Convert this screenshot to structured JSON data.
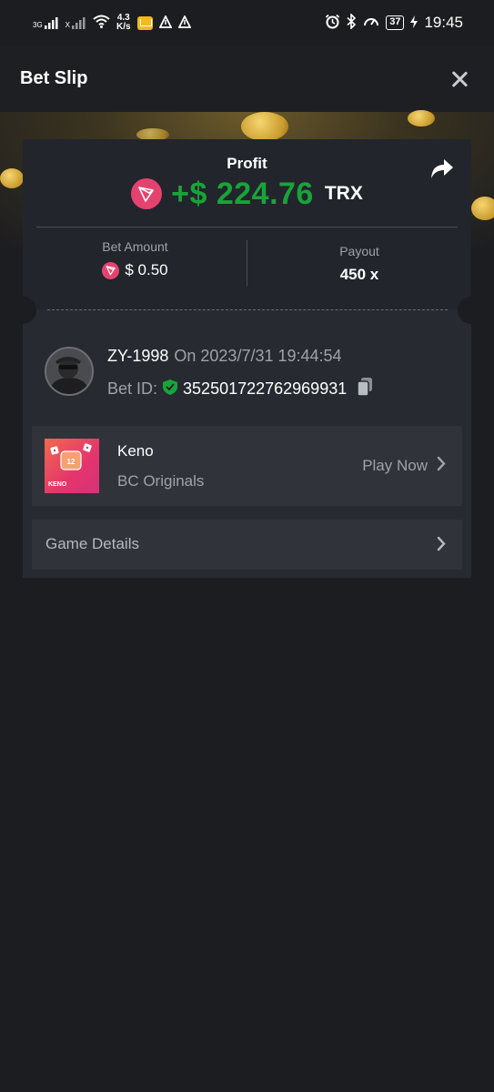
{
  "status_bar": {
    "network_1": "3G",
    "network_2": "X",
    "speed_value": "4.3",
    "speed_unit": "K/s",
    "battery": "37",
    "time": "19:45"
  },
  "header": {
    "title": "Bet Slip"
  },
  "profit": {
    "label": "Profit",
    "value": "+$ 224.76",
    "currency": "TRX"
  },
  "bet_amount": {
    "label": "Bet Amount",
    "value": "$ 0.50"
  },
  "payout": {
    "label": "Payout",
    "value": "450 x"
  },
  "user": {
    "name": "ZY-1998",
    "date": "On 2023/7/31 19:44:54",
    "bet_id_label": "Bet ID:",
    "bet_id": "352501722762969931"
  },
  "game": {
    "name": "Keno",
    "provider": "BC Originals",
    "thumb_label": "KENO",
    "thumb_number": "12",
    "play_label": "Play Now"
  },
  "details": {
    "label": "Game Details"
  },
  "colors": {
    "profit_green": "#19a33a",
    "tron_red": "#e5436f",
    "background": "#1c1d20",
    "card": "#272a30"
  }
}
